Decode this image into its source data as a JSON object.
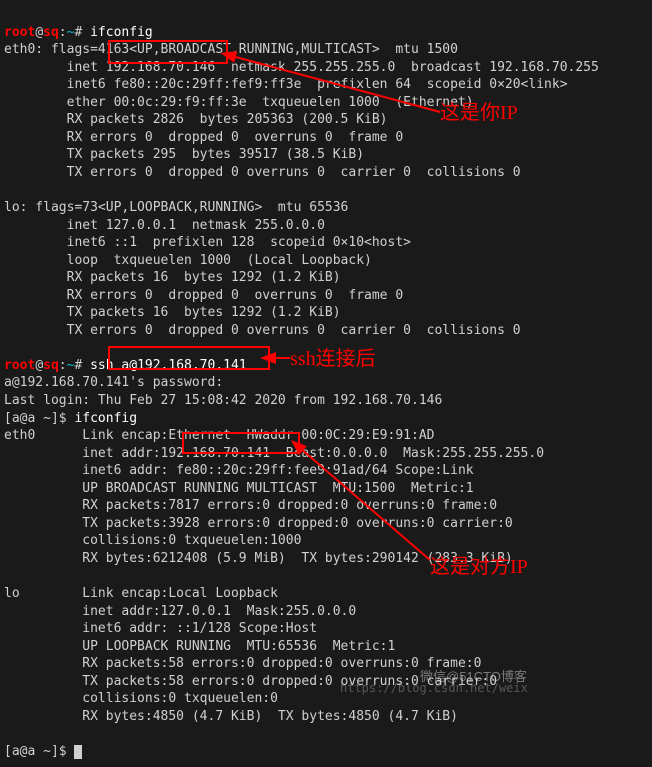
{
  "prompt1": {
    "user": "root",
    "at": "@",
    "host": "sq",
    "colon": ":",
    "tilde": "~",
    "hash": "# "
  },
  "cmd1": "ifconfig",
  "eth0": {
    "l1": "eth0: flags=4163<UP,BROADCAST,RUNNING,MULTICAST>  mtu 1500",
    "l2": "        inet 192.168.70.146  netmask 255.255.255.0  broadcast 192.168.70.255",
    "l3": "        inet6 fe80::20c:29ff:fef9:ff3e  prefixlen 64  scopeid 0×20<link>",
    "l4": "        ether 00:0c:29:f9:ff:3e  txqueuelen 1000  (Ethernet)",
    "l5": "        RX packets 2826  bytes 205363 (200.5 KiB)",
    "l6": "        RX errors 0  dropped 0  overruns 0  frame 0",
    "l7": "        TX packets 295  bytes 39517 (38.5 KiB)",
    "l8": "        TX errors 0  dropped 0 overruns 0  carrier 0  collisions 0"
  },
  "lo": {
    "l1": "lo: flags=73<UP,LOOPBACK,RUNNING>  mtu 65536",
    "l2": "        inet 127.0.0.1  netmask 255.0.0.0",
    "l3": "        inet6 ::1  prefixlen 128  scopeid 0×10<host>",
    "l4": "        loop  txqueuelen 1000  (Local Loopback)",
    "l5": "        RX packets 16  bytes 1292 (1.2 KiB)",
    "l6": "        RX errors 0  dropped 0  overruns 0  frame 0",
    "l7": "        TX packets 16  bytes 1292 (1.2 KiB)",
    "l8": "        TX errors 0  dropped 0 overruns 0  carrier 0  collisions 0"
  },
  "cmd2": "ssh a@192.168.70.141",
  "ssh": {
    "l1": "a@192.168.70.141's password:",
    "l2": "Last login: Thu Feb 27 15:08:42 2020 from 192.168.70.146"
  },
  "prompt2": "[a@a ~]$ ",
  "cmd3": "ifconfig",
  "eth0b": {
    "l1": "eth0      Link encap:Ethernet  HWaddr 00:0C:29:E9:91:AD",
    "l2": "          inet addr:192.168.70.141  Bcast:0.0.0.0  Mask:255.255.255.0",
    "l3": "          inet6 addr: fe80::20c:29ff:fee9:91ad/64 Scope:Link",
    "l4": "          UP BROADCAST RUNNING MULTICAST  MTU:1500  Metric:1",
    "l5": "          RX packets:7817 errors:0 dropped:0 overruns:0 frame:0",
    "l6": "          TX packets:3928 errors:0 dropped:0 overruns:0 carrier:0",
    "l7": "          collisions:0 txqueuelen:1000",
    "l8": "          RX bytes:6212408 (5.9 MiB)  TX bytes:290142 (283.3 KiB)"
  },
  "lob": {
    "l1": "lo        Link encap:Local Loopback",
    "l2": "          inet addr:127.0.0.1  Mask:255.0.0.0",
    "l3": "          inet6 addr: ::1/128 Scope:Host",
    "l4": "          UP LOOPBACK RUNNING  MTU:65536  Metric:1",
    "l5": "          RX packets:58 errors:0 dropped:0 overruns:0 frame:0",
    "l6": "          TX packets:58 errors:0 dropped:0 overruns:0 carrier:0",
    "l7": "          collisions:0 txqueuelen:0",
    "l8": "          RX bytes:4850 (4.7 KiB)  TX bytes:4850 (4.7 KiB)"
  },
  "prompt3": "[a@a ~]$ ",
  "annotations": {
    "yourip": "这是你IP",
    "sshafter": "ssh连接后",
    "peerip": "这是对方IP"
  },
  "watermarks": {
    "cto": "微信@51CTO博客",
    "csdn": "https://blog.csdn.net/weix"
  }
}
